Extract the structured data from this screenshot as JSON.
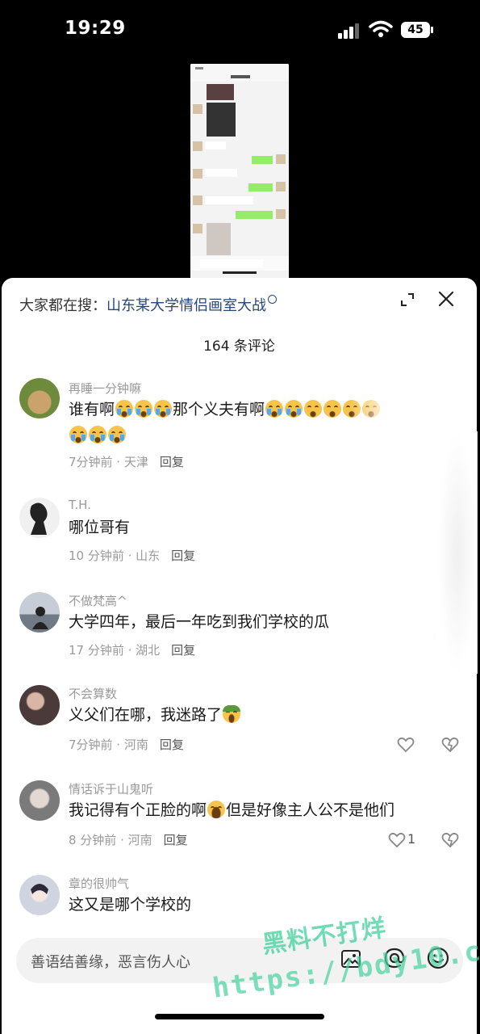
{
  "status_bar": {
    "time": "19:29",
    "battery": "45"
  },
  "search": {
    "prefix": "大家都在搜：",
    "query": "山东某大学情侣画室大战"
  },
  "comment_count": "164 条评论",
  "comments": [
    {
      "name": "再睡一分钟嘛",
      "text_a": "谁有啊",
      "text_b": "那个义夫有啊",
      "meta": "7分钟前 · 天津",
      "reply": "回复",
      "avatar_color": "#6d8a3d"
    },
    {
      "name": "T.H.",
      "text": "哪位哥有",
      "meta": "10 分钟前 · 山东",
      "reply": "回复",
      "avatar_color": "#e8e8e8"
    },
    {
      "name": "不做梵高^",
      "text": "大学四年，最后一年吃到我们学校的瓜",
      "meta": "17 分钟前 · 湖北",
      "reply": "回复",
      "avatar_color": "#8a9bb0"
    },
    {
      "name": "不会算数",
      "text": "义父们在哪，我迷路了",
      "meta": "7分钟前 · 河南",
      "reply": "回复",
      "avatar_color": "#4a3a3a"
    },
    {
      "name": "情话诉于山鬼听",
      "text_a": "我记得有个正脸的啊",
      "text_b": "但是好像主人公不是他们",
      "meta": "8 分钟前 · 河南",
      "reply": "回复",
      "likes": "1",
      "avatar_color": "#7a7a7a"
    },
    {
      "name": "章的很帅气",
      "text": "这又是哪个学校的",
      "meta": "",
      "reply": "",
      "avatar_color": "#cfd4e0"
    }
  ],
  "input": {
    "placeholder": "善语结善缘，恶言伤人心"
  },
  "watermark": {
    "line1": "黑料不打烊",
    "line2": "https://bdy10.co"
  },
  "icons": [
    "signal-icon",
    "wifi-icon",
    "battery-icon",
    "expand-icon",
    "close-icon",
    "search-icon",
    "heart-icon",
    "dislike-icon",
    "image-icon",
    "at-icon",
    "emoji-icon"
  ]
}
